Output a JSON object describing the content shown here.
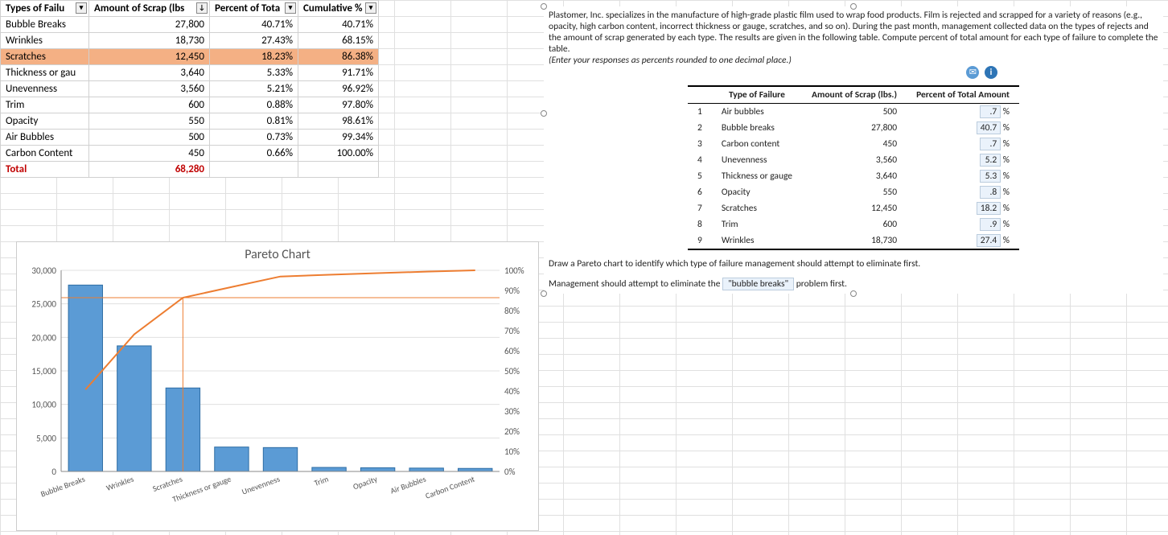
{
  "left_table": {
    "headers": [
      "Types of Failu",
      "Amount of Scrap (lbs",
      "Percent of Tota",
      "Cumulative %"
    ],
    "rows": [
      {
        "type": "Bubble Breaks",
        "amt": "27,800",
        "pct": "40.71%",
        "cum": "40.71%",
        "hl": false
      },
      {
        "type": "Wrinkles",
        "amt": "18,730",
        "pct": "27.43%",
        "cum": "68.15%",
        "hl": false
      },
      {
        "type": "Scratches",
        "amt": "12,450",
        "pct": "18.23%",
        "cum": "86.38%",
        "hl": true
      },
      {
        "type": "Thickness or gau",
        "amt": "3,640",
        "pct": "5.33%",
        "cum": "91.71%",
        "hl": false
      },
      {
        "type": "Unevenness",
        "amt": "3,560",
        "pct": "5.21%",
        "cum": "96.92%",
        "hl": false
      },
      {
        "type": "Trim",
        "amt": "600",
        "pct": "0.88%",
        "cum": "97.80%",
        "hl": false
      },
      {
        "type": "Opacity",
        "amt": "550",
        "pct": "0.81%",
        "cum": "98.61%",
        "hl": false
      },
      {
        "type": "Air Bubbles",
        "amt": "500",
        "pct": "0.73%",
        "cum": "99.34%",
        "hl": false
      },
      {
        "type": "Carbon Content",
        "amt": "450",
        "pct": "0.66%",
        "cum": "100.00%",
        "hl": false
      }
    ],
    "total_label": "Total",
    "total_value": "68,280"
  },
  "chart_title": "Pareto Chart",
  "chart_data": {
    "type": "bar+line",
    "categories": [
      "Bubble Breaks",
      "Wrinkles",
      "Scratches",
      "Thickness or gauge",
      "Unevenness",
      "Trim",
      "Opacity",
      "Air Bubbles",
      "Carbon Content"
    ],
    "series": [
      {
        "name": "Amount",
        "axis": "left",
        "values": [
          27800,
          18730,
          12450,
          3640,
          3560,
          600,
          550,
          500,
          450
        ]
      },
      {
        "name": "Cumulative %",
        "axis": "right",
        "values": [
          40.71,
          68.15,
          86.38,
          91.71,
          96.92,
          97.8,
          98.61,
          99.34,
          100.0
        ]
      }
    ],
    "y_left": {
      "min": 0,
      "max": 30000,
      "step": 5000,
      "labels": [
        "0",
        "5,000",
        "10,000",
        "15,000",
        "20,000",
        "25,000",
        "30,000"
      ]
    },
    "y_right": {
      "min": 0,
      "max": 100,
      "step": 10,
      "labels": [
        "0%",
        "10%",
        "20%",
        "30%",
        "40%",
        "50%",
        "60%",
        "70%",
        "80%",
        "90%",
        "100%"
      ]
    },
    "colors": {
      "bar": "#5b9bd5",
      "line": "#ed7d31"
    },
    "title": "Pareto Chart"
  },
  "panel": {
    "para": "Plastomer, Inc. specializes in the manufacture of high-grade plastic film used to wrap food products. Film is rejected and scrapped for a variety of reasons (e.g., opacity, high carbon content, incorrect thickness or gauge, scratches, and so on). During the past month, management collected data on the types of rejects and the amount of scrap generated by each type. The results are given in the following table. Compute percent of total amount for each type of failure to complete the table.",
    "instr": "(Enter your responses as percents rounded to one decimal place.)",
    "headers": [
      "Type of Failure",
      "Amount of Scrap (lbs.)",
      "Percent of Total Amount"
    ],
    "rows": [
      {
        "n": "1",
        "t": "Air bubbles",
        "a": "500",
        "p": ".7"
      },
      {
        "n": "2",
        "t": "Bubble breaks",
        "a": "27,800",
        "p": "40.7"
      },
      {
        "n": "3",
        "t": "Carbon content",
        "a": "450",
        "p": ".7"
      },
      {
        "n": "4",
        "t": "Unevenness",
        "a": "3,560",
        "p": "5.2"
      },
      {
        "n": "5",
        "t": "Thickness or gauge",
        "a": "3,640",
        "p": "5.3"
      },
      {
        "n": "6",
        "t": "Opacity",
        "a": "550",
        "p": ".8"
      },
      {
        "n": "7",
        "t": "Scratches",
        "a": "12,450",
        "p": "18.2"
      },
      {
        "n": "8",
        "t": "Trim",
        "a": "600",
        "p": ".9"
      },
      {
        "n": "9",
        "t": "Wrinkles",
        "a": "18,730",
        "p": "27.4"
      }
    ],
    "q2": "Draw a Pareto chart to identify which type of failure management should attempt to eliminate first.",
    "ans_pre": "Management should attempt to eliminate the",
    "ans_val": "\"bubble breaks\"",
    "ans_post": "problem first."
  }
}
